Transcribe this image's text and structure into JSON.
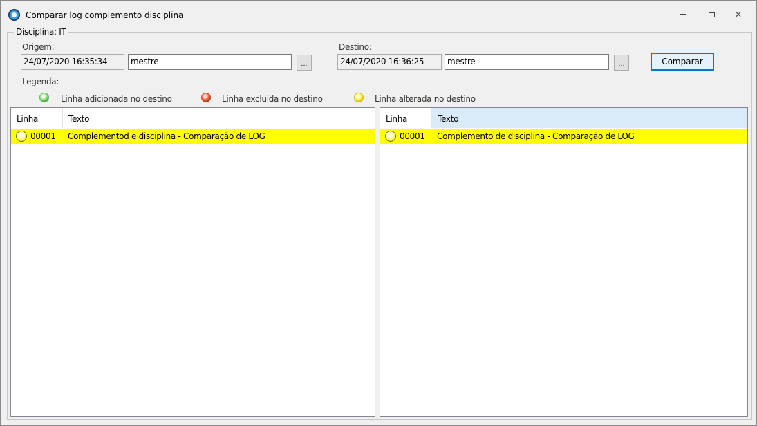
{
  "window": {
    "title": "Comparar log complemento disciplina",
    "min_glyph": "",
    "max_glyph": "",
    "close_glyph": "✕"
  },
  "group": {
    "legend": "Disciplina: IT"
  },
  "origem": {
    "label": "Origem:",
    "date": "24/07/2020 16:35:34",
    "user": "mestre",
    "browse_label": "..."
  },
  "destino": {
    "label": "Destino:",
    "date": "24/07/2020 16:36:25",
    "user": "mestre",
    "browse_label": "..."
  },
  "compare_button": "Comparar",
  "legenda": {
    "label": "Legenda:",
    "items": [
      {
        "label": "Linha adicionada no destino",
        "icon": "green-dot-icon",
        "color": "#4cbf45"
      },
      {
        "label": "Linha excluída no destino",
        "icon": "red-dot-icon",
        "color": "#e2461c"
      },
      {
        "label": "Linha alterada no destino",
        "icon": "yellow-dot-icon",
        "color": "#f2e100"
      }
    ]
  },
  "left_grid": {
    "columns": [
      "Linha",
      "Texto"
    ],
    "rows": [
      {
        "linha": "00001",
        "texto": "Complementod e disciplina - Comparação de LOG",
        "highlight": "#ffff00"
      }
    ]
  },
  "right_grid": {
    "columns": [
      "Linha",
      "Texto"
    ],
    "rows": [
      {
        "linha": "00001",
        "texto": "Complemento de disciplina - Comparação de LOG",
        "highlight": "#ffff00"
      }
    ]
  }
}
